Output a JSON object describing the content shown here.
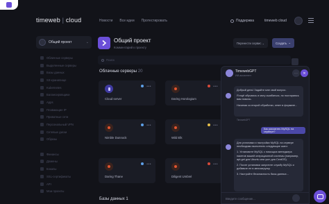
{
  "header": {
    "logo_brand": "timeweb",
    "logo_sep": " | ",
    "logo_suffix": "cloud",
    "nav": [
      "Новости",
      "Все идеи",
      "Протестировать"
    ],
    "support": "Поддержка",
    "account": "timeweb cloud"
  },
  "sidebar": {
    "project": "Общий проект",
    "items": [
      "Облачные серверы",
      "Выделенные серверы",
      "Базы данных",
      "S3-хранилище",
      "Kubernetes",
      "Балансировщики",
      "Apps",
      "Плавающие IP",
      "Приватные сети",
      "Персональный VPN",
      "Сетевые диски",
      "Образы",
      "",
      "Финансы",
      "Домены",
      "Бэкапы",
      "SSL-сертификаты",
      "API",
      "Мои проекты"
    ]
  },
  "main": {
    "title": "Общий проект",
    "subtitle": "Комментарий к проекту",
    "move_button": "Перенести сервис",
    "create_button": "Создать",
    "search_placeholder": "Поиск",
    "servers_title": "Облачные серверы",
    "servers_count": "20",
    "servers": [
      {
        "name": "Cloud server",
        "icon": "purple"
      },
      {
        "name": "Daring Horologium",
        "icon": "orange"
      },
      {
        "name": "Nimble Dunnock",
        "icon": "orange"
      },
      {
        "name": "Wild Elk",
        "icon": "orange"
      },
      {
        "name": "Daring Thane",
        "icon": "orange"
      },
      {
        "name": "Diligent Umbrel",
        "icon": "orange"
      }
    ],
    "databases_title": "Базы данных 1"
  },
  "chat": {
    "title": "TimewebGPT",
    "subtitle": "ИИ-ассистент",
    "greeting": [
      "Добрый день! Задайте мне свой вопрос.",
      "Я ещё обучаюсь и могу ошибаться, но постараюсь вам помочь.",
      "Начиная со второй обработки, ответ в формате..."
    ],
    "bot_name": "TimewebGPT",
    "user_message": "Как раскатать MySQL на сервере?",
    "answer": [
      "Для установки и настройки MySQL на сервере необходимо выполнить следующие шаги:",
      "1. Установите MySQL с помощью менеджера пакетов вашей операционной системы (например, apt-get для Ubuntu или yum для CentOS).",
      "2. После установки запустите службу MySQL и добавьте ее в автозагрузку.",
      "3. Настройте безопасность базы данных..."
    ],
    "input_placeholder": "Введите сообщение..."
  },
  "colors": {
    "accent": "#6b4fd8",
    "background": "#121319",
    "panel": "#1a1c25"
  }
}
